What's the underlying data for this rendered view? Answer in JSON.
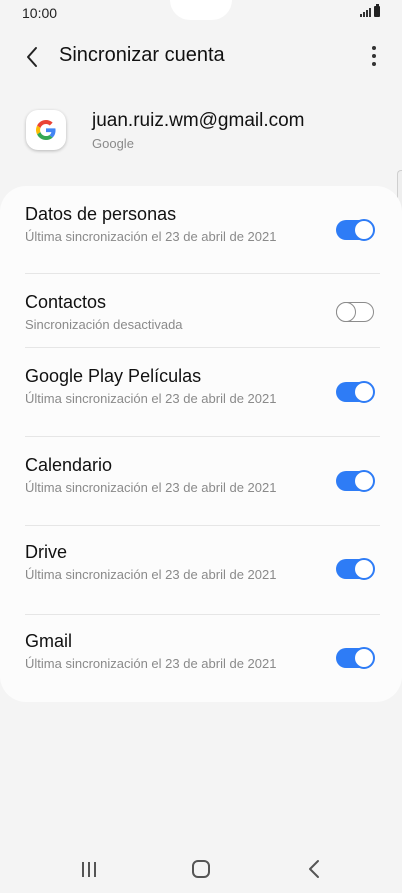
{
  "status_bar": {
    "time": "10:00"
  },
  "header": {
    "title": "Sincronizar cuenta"
  },
  "account": {
    "email": "juan.ruiz.wm@gmail.com",
    "type": "Google"
  },
  "sync_items": [
    {
      "label": "Datos de personas",
      "subtitle": "Última sincronización el 23 de abril de 2021",
      "enabled": true
    },
    {
      "label": "Contactos",
      "subtitle": "Sincronización desactivada",
      "enabled": false
    },
    {
      "label": "Google Play Películas",
      "subtitle": "Última sincronización el 23 de abril de 2021",
      "enabled": true
    },
    {
      "label": "Calendario",
      "subtitle": "Última sincronización el 23 de abril de 2021",
      "enabled": true
    },
    {
      "label": "Drive",
      "subtitle": "Última sincronización el 23 de abril de 2021",
      "enabled": true
    },
    {
      "label": "Gmail",
      "subtitle": "Última sincronización el 23 de abril de 2021",
      "enabled": true
    }
  ],
  "icons": {
    "back": "back-arrow-icon",
    "more": "more-vert-icon",
    "account_logo": "google-g-icon",
    "nav_recents": "recent-apps-icon",
    "nav_home": "home-icon",
    "nav_back": "nav-back-icon"
  },
  "colors": {
    "accent": "#2e7cf6",
    "background": "#f4f4f4",
    "card": "#fcfcfc"
  }
}
